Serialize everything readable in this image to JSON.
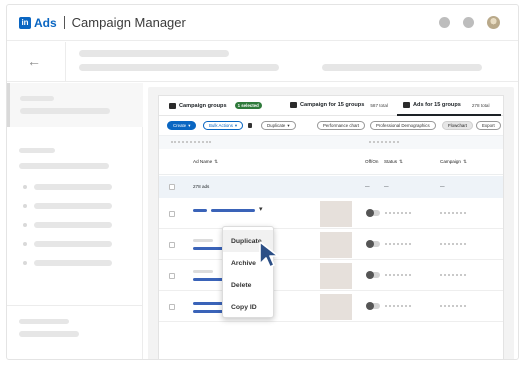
{
  "header": {
    "logo_mark": "in",
    "logo_text": "Ads",
    "app_title": "Campaign Manager",
    "icons": [
      "notification-dot-icon",
      "messages-dot-icon",
      "avatar"
    ]
  },
  "subheader": {
    "back_icon": "←"
  },
  "tabs": [
    {
      "label": "Campaign groups",
      "badge": "1 selected",
      "icon": "folder-icon"
    },
    {
      "label": "Campaign for 15 groups",
      "count": "587 total",
      "icon": "campaign-icon"
    },
    {
      "label": "Ads for 15 groups",
      "count": "278 total",
      "icon": "ad-icon"
    }
  ],
  "toolbar": {
    "create": "Create",
    "bulk": "Bulk Actions",
    "duplicate": "Duplicate",
    "performance": "Performance chart",
    "demographics": "Professional Demographics",
    "flowchart": "Flowchart",
    "export": "Export"
  },
  "table": {
    "columns": {
      "ad_name": "Ad Name",
      "off_on": "Off/On",
      "status": "Status",
      "campaign": "Campaign"
    },
    "total_row": {
      "name": "278 ads",
      "off_on": "—",
      "status": "—",
      "campaign": "—"
    }
  },
  "context_menu": {
    "items": [
      "Duplicate",
      "Archive",
      "Delete",
      "Copy ID"
    ],
    "highlighted": "Duplicate"
  },
  "colors": {
    "brand_blue": "#0a66c2",
    "badge_green": "#2f7a3b",
    "row_bar_blue": "#3a63b8"
  }
}
